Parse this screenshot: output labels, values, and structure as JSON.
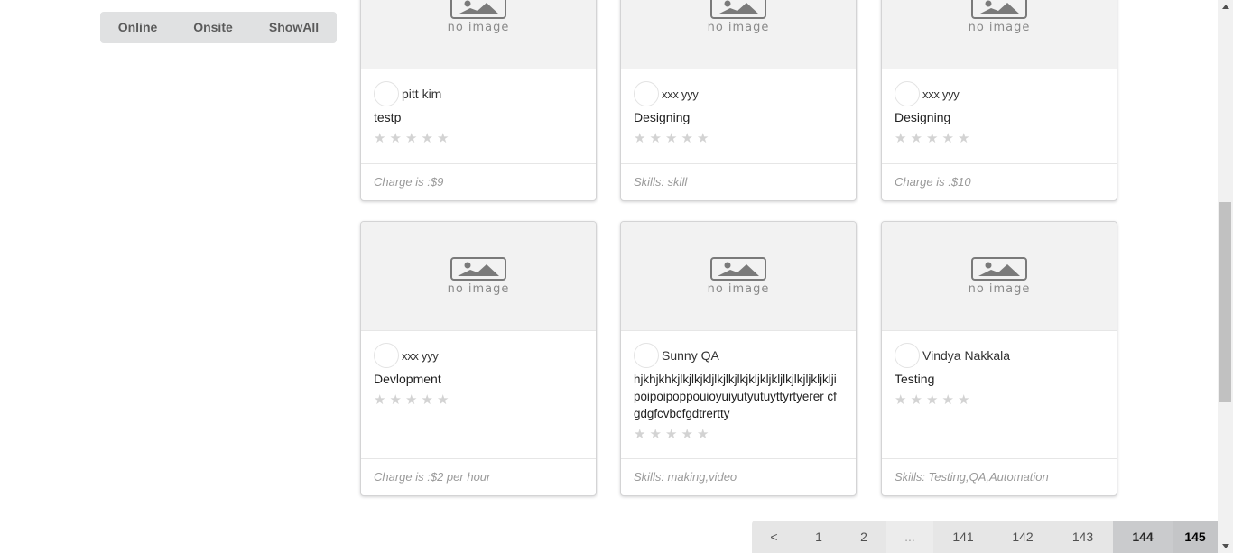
{
  "filters": {
    "online": "Online",
    "onsite": "Onsite",
    "showall": "ShowAll"
  },
  "no_image_text": "no image",
  "cards": [
    {
      "user": "pitt kim",
      "title": "testp",
      "footer": "Charge is :$9"
    },
    {
      "user": "xxx yyy",
      "title": "Designing",
      "footer": "Skills: skill"
    },
    {
      "user": "xxx yyy",
      "title": "Designing",
      "footer": "Charge is :$10"
    },
    {
      "user": "xxx yyy",
      "title": "Devlopment",
      "footer": "Charge is :$2 per hour"
    },
    {
      "user": "Sunny QA",
      "title": "hjkhjkhkjlkjlkjkljlkjlkjlkjkljkljkljlkjlkjljkljklji poipoipoppouioyuiyutyutuyttyrtyerer cfgdgfcvbcfgdtrertty",
      "footer": "Skills: making,video"
    },
    {
      "user": "Vindya Nakkala",
      "title": "Testing",
      "footer": "Skills: Testing,QA,Automation"
    }
  ],
  "rating_icon": "star-icon",
  "rating_value": 0,
  "pagination": {
    "prev": "<",
    "pages": [
      "1",
      "2",
      "...",
      "141",
      "142",
      "143",
      "144",
      "145"
    ],
    "active": "144",
    "current_last": "145"
  }
}
